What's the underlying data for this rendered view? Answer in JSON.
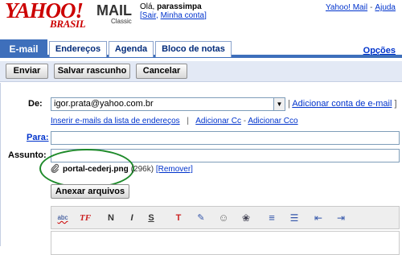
{
  "header": {
    "logo_text": "YAHOO!",
    "logo_sub": "BRASIL",
    "product": "MAIL",
    "product_sub": "Classic",
    "greeting_prefix": "Olá,",
    "username": "parassimpa",
    "account_links": {
      "open": "[",
      "logout": "Sair",
      "separator": ",",
      "my_account": "Minha conta",
      "close": "]"
    },
    "top_links": {
      "yahoo_mail": "Yahoo! Mail",
      "separator": "-",
      "help": "Ajuda"
    }
  },
  "tabs": [
    {
      "label": "E-mail",
      "active": true
    },
    {
      "label": "Endereços",
      "active": false
    },
    {
      "label": "Agenda",
      "active": false
    },
    {
      "label": "Bloco de notas",
      "active": false
    }
  ],
  "options_link": "Opções",
  "toolbar": {
    "send_label": "Enviar",
    "save_draft_label": "Salvar rascunho",
    "cancel_label": "Cancelar"
  },
  "compose": {
    "from_label": "De:",
    "from_value": "igor.prata@yahoo.com.br",
    "add_account": {
      "prefix": "|",
      "label": "Adicionar conta de e-mail",
      "suffix": "]"
    },
    "insert_from_addressbook": "Inserir e-mails da lista de endereços",
    "sublink_sep": "|",
    "add_cc": "Adicionar Cc",
    "cc_bcc_sep": "-",
    "add_bcc": "Adicionar Cco",
    "to_label": "Para:",
    "to_value": "",
    "subject_label": "Assunto:",
    "subject_value": "",
    "attachment": {
      "filename": "portal-cederj.png",
      "size": "(296k)",
      "remove_label": "[Remover]"
    },
    "attach_button_label": "Anexar arquivos"
  },
  "editor_toolbar": [
    {
      "icon": "spellcheck-icon",
      "glyph": "abc"
    },
    {
      "icon": "font-icon",
      "glyph": "TF"
    },
    {
      "icon": "bold-icon",
      "glyph": "N"
    },
    {
      "icon": "italic-icon",
      "glyph": "I"
    },
    {
      "icon": "strikethrough-icon",
      "glyph": "S"
    },
    {
      "icon": "text-color-icon",
      "glyph": "T"
    },
    {
      "icon": "highlight-icon",
      "glyph": "✎"
    },
    {
      "icon": "emoticon-icon",
      "glyph": "☺"
    },
    {
      "icon": "stationery-icon",
      "glyph": "❀"
    },
    {
      "icon": "align-icon",
      "glyph": "≡"
    },
    {
      "icon": "bullet-list-icon",
      "glyph": "☰"
    },
    {
      "icon": "outdent-icon",
      "glyph": "⇤"
    },
    {
      "icon": "indent-icon",
      "glyph": "⇥"
    }
  ],
  "colors": {
    "logo_red": "#cc0000",
    "tab_blue": "#3e6fbb",
    "toolbar_bg": "#e3e9f5",
    "link_blue": "#0033cc",
    "highlight_green": "#1e8a2a"
  }
}
